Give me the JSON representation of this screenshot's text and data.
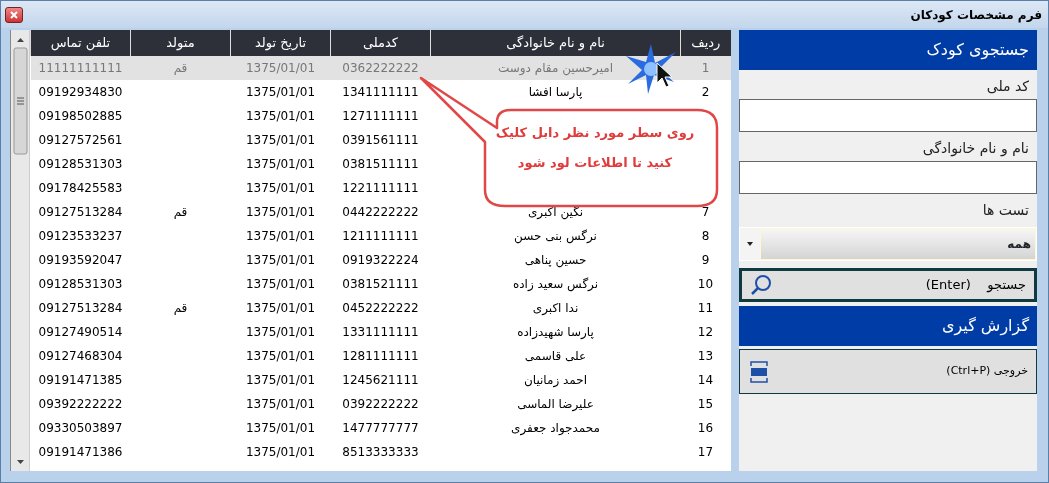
{
  "window": {
    "title": "فرم مشخصات کودکان"
  },
  "table": {
    "columns": [
      "ردیف",
      "نام و نام خانوادگی",
      "کدملی",
      "تاریخ تولد",
      "متولد",
      "تلفن تماس"
    ],
    "rows": [
      {
        "selected": true,
        "cells": [
          "1",
          "امیرحسین مقام دوست",
          "0362222222",
          "1375/01/01",
          "قم",
          "11111111111"
        ]
      },
      {
        "selected": false,
        "cells": [
          "2",
          "پارسا افشا",
          "1341111111",
          "1375/01/01",
          null,
          "09192934830"
        ]
      },
      {
        "selected": false,
        "cells": [
          null,
          null,
          "1271111111",
          "1375/01/01",
          null,
          "09198502885"
        ]
      },
      {
        "selected": false,
        "cells": [
          null,
          null,
          "0391561111",
          "1375/01/01",
          null,
          "09127572561"
        ]
      },
      {
        "selected": false,
        "cells": [
          null,
          null,
          "0381511111",
          "1375/01/01",
          null,
          "09128531303"
        ]
      },
      {
        "selected": false,
        "cells": [
          null,
          null,
          "1221111111",
          "1375/01/01",
          null,
          "09178425583"
        ]
      },
      {
        "selected": false,
        "cells": [
          "7",
          "نگین اکبری",
          "0442222222",
          "1375/01/01",
          "قم",
          "09127513284"
        ]
      },
      {
        "selected": false,
        "cells": [
          "8",
          "نرگس بنی حسن",
          "1211111111",
          "1375/01/01",
          null,
          "09123533237"
        ]
      },
      {
        "selected": false,
        "cells": [
          "9",
          "حسین پناهی",
          "0919322224",
          "1375/01/01",
          null,
          "09193592047"
        ]
      },
      {
        "selected": false,
        "cells": [
          "10",
          "نرگس سعید زاده",
          "0381521111",
          "1375/01/01",
          null,
          "09128531303"
        ]
      },
      {
        "selected": false,
        "cells": [
          "11",
          "ندا اکبری",
          "0452222222",
          "1375/01/01",
          "قم",
          "09127513284"
        ]
      },
      {
        "selected": false,
        "cells": [
          "12",
          "پارسا شهیدزاده",
          "1331111111",
          "1375/01/01",
          null,
          "09127490514"
        ]
      },
      {
        "selected": false,
        "cells": [
          "13",
          "علی قاسمی",
          "1281111111",
          "1375/01/01",
          null,
          "09127468304"
        ]
      },
      {
        "selected": false,
        "cells": [
          "14",
          "احمد زمانیان",
          "1245621111",
          "1375/01/01",
          null,
          "09191471385"
        ]
      },
      {
        "selected": false,
        "cells": [
          "15",
          "علیرضا الماسی",
          "0392222222",
          "1375/01/01",
          null,
          "09392222222"
        ]
      },
      {
        "selected": false,
        "cells": [
          "16",
          "محمدجواد جعفری",
          "1477777777",
          "1375/01/01",
          null,
          "09330503897"
        ]
      },
      {
        "selected": false,
        "cells": [
          "17",
          null,
          "8513333333",
          "1375/01/01",
          null,
          "09191471386"
        ]
      }
    ]
  },
  "callout": {
    "text": "روی سطر مورد نظر دابل کلیک کنید تا اطلاعات لود شود"
  },
  "search_panel": {
    "title": "جستجوی  کودک",
    "fields": [
      {
        "label": "کد ملی"
      },
      {
        "label": "نام و نام خانوادگی"
      }
    ],
    "tests": {
      "label": "تست ها",
      "value": "همه"
    },
    "search_button": {
      "label": "جستجو",
      "shortcut": "(Enter)"
    }
  },
  "report_panel": {
    "title": "گزارش گیری",
    "export_button": {
      "label": "خروجی (Ctrl+P)"
    }
  }
}
